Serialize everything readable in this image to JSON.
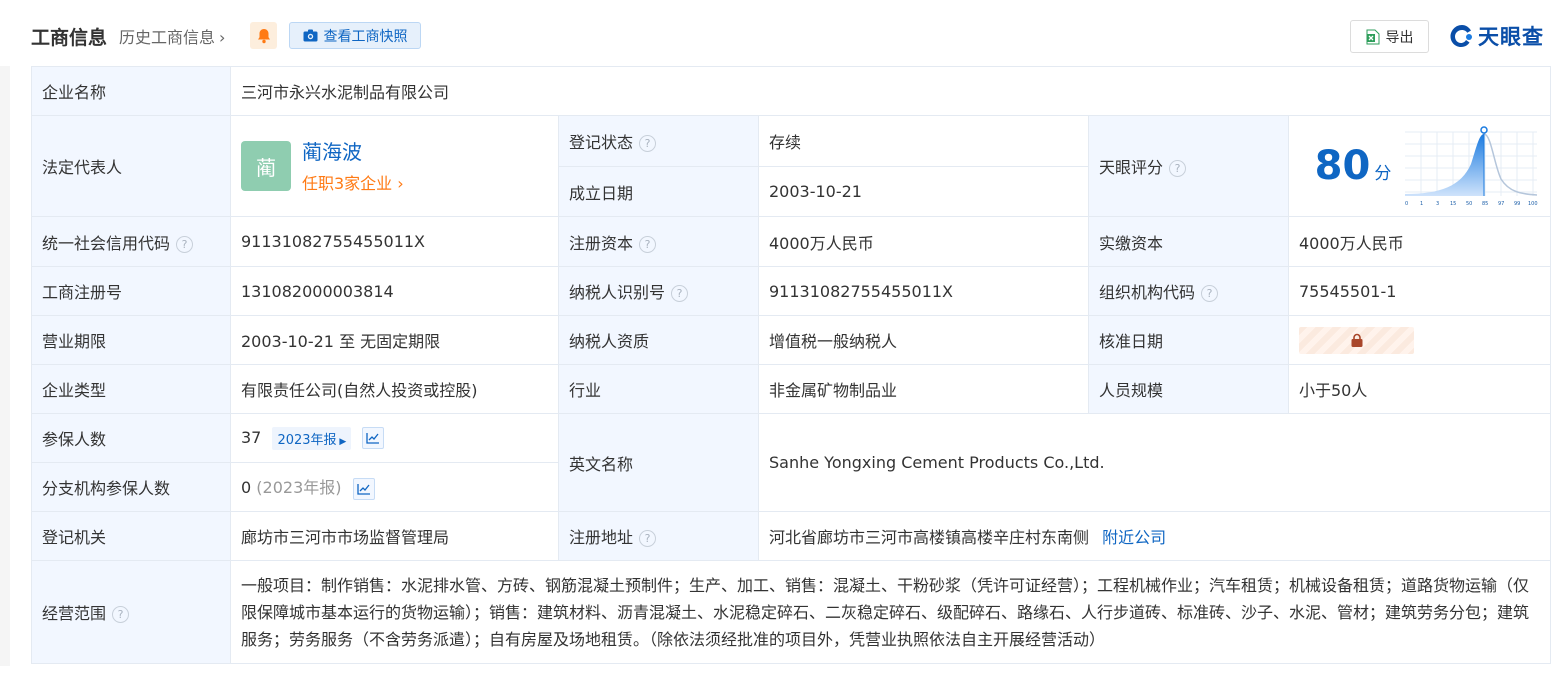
{
  "header": {
    "title": "工商信息",
    "history_link": "历史工商信息",
    "snapshot_button": "查看工商快照",
    "export_button": "导出",
    "brand": "天眼查"
  },
  "rows": {
    "company_name": {
      "label": "企业名称",
      "value": "三河市永兴水泥制品有限公司"
    },
    "legal_rep": {
      "label": "法定代表人",
      "avatar_char": "蔺",
      "name": "蔺海波",
      "sub": "任职3家企业"
    },
    "reg_status": {
      "label": "登记状态",
      "value": "存续"
    },
    "founded": {
      "label": "成立日期",
      "value": "2003-10-21"
    },
    "score": {
      "label": "天眼评分",
      "value": "80",
      "unit": "分",
      "axis_ticks": [
        "0",
        "1",
        "3",
        "15",
        "50",
        "85",
        "97",
        "99",
        "100"
      ]
    },
    "credit_code": {
      "label": "统一社会信用代码",
      "value": "91131082755455011X"
    },
    "reg_capital": {
      "label": "注册资本",
      "value": "4000万人民币"
    },
    "paid_capital": {
      "label": "实缴资本",
      "value": "4000万人民币"
    },
    "reg_no": {
      "label": "工商注册号",
      "value": "131082000003814"
    },
    "taxpayer_id": {
      "label": "纳税人识别号",
      "value": "91131082755455011X"
    },
    "org_code": {
      "label": "组织机构代码",
      "value": "75545501-1"
    },
    "term": {
      "label": "营业期限",
      "value": "2003-10-21 至 无固定期限"
    },
    "taxpayer_qual": {
      "label": "纳税人资质",
      "value": "增值税一般纳税人"
    },
    "approve_date": {
      "label": "核准日期"
    },
    "company_type": {
      "label": "企业类型",
      "value": "有限责任公司(自然人投资或控股)"
    },
    "industry": {
      "label": "行业",
      "value": "非金属矿物制品业"
    },
    "staff_size": {
      "label": "人员规模",
      "value": "小于50人"
    },
    "insured": {
      "label": "参保人数",
      "value": "37",
      "year_tag": "2023年报"
    },
    "branch_insured": {
      "label": "分支机构参保人数",
      "value": "0",
      "year_note": "(2023年报)"
    },
    "english_name": {
      "label": "英文名称",
      "value": "Sanhe Yongxing Cement Products Co.,Ltd."
    },
    "authority": {
      "label": "登记机关",
      "value": "廊坊市三河市市场监督管理局"
    },
    "address": {
      "label": "注册地址",
      "value": "河北省廊坊市三河市高楼镇高楼辛庄村东南侧",
      "link": "附近公司"
    },
    "scope": {
      "label": "经营范围",
      "value": "一般项目：制作销售：水泥排水管、方砖、钢筋混凝土预制件；生产、加工、销售：混凝土、干粉砂浆（凭许可证经营）；工程机械作业；汽车租赁；机械设备租赁；道路货物运输（仅限保障城市基本运行的货物运输）；销售：建筑材料、沥青混凝土、水泥稳定碎石、二灰稳定碎石、级配碎石、路缘石、人行步道砖、标准砖、沙子、水泥、管材；建筑劳务分包；建筑服务；劳务服务（不含劳务派遣）；自有房屋及场地租赁。（除依法须经批准的项目外，凭营业执照依法自主开展经营活动）"
    }
  },
  "colors": {
    "accent": "#0f66c3",
    "label_bg": "#f2f7ff",
    "status_green": "#39a56b",
    "orange": "#ff7a14"
  }
}
